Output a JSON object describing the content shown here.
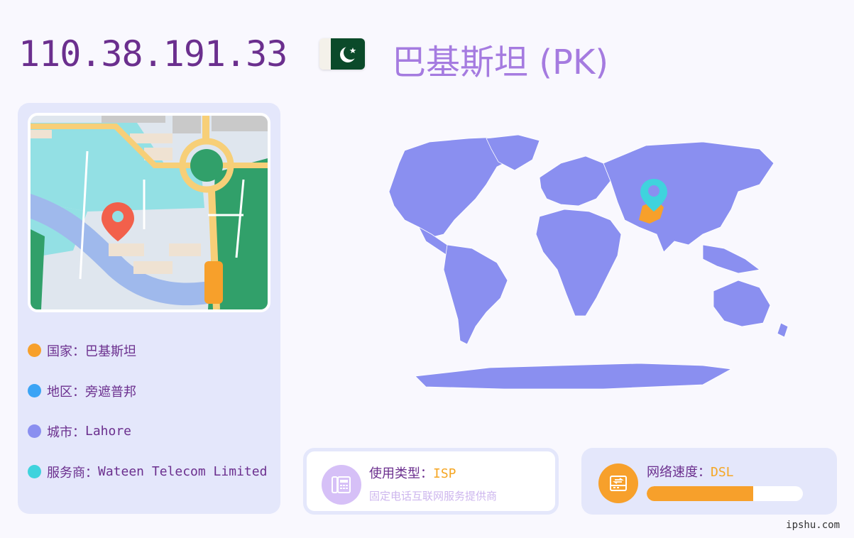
{
  "header": {
    "ip": "110.38.191.33",
    "country_title": "巴基斯坦 (PK)"
  },
  "info": [
    {
      "label": "国家：",
      "value": "巴基斯坦",
      "color": "#f7a02b"
    },
    {
      "label": "地区：",
      "value": "旁遮普邦",
      "color": "#3ba4f5"
    },
    {
      "label": "城市：",
      "value": "Lahore",
      "color": "#8a8ff0"
    },
    {
      "label": "服务商：",
      "value": "Wateen Telecom Limited",
      "color": "#3fd3dd"
    }
  ],
  "isp_card": {
    "label": "使用类型：",
    "value": "ISP",
    "sub": "固定电话互联网服务提供商",
    "icon": "telephone-icon"
  },
  "speed_card": {
    "label": "网络速度：",
    "value": "DSL",
    "progress": 0.68,
    "icon": "router-icon"
  },
  "watermark": "ipshu.com",
  "colors": {
    "accent_purple": "#6b2f8e",
    "title_purple": "#a57be0",
    "map_fill": "#8a8ff0",
    "highlight": "#f7a02b",
    "marker": "#3fd3dd"
  }
}
